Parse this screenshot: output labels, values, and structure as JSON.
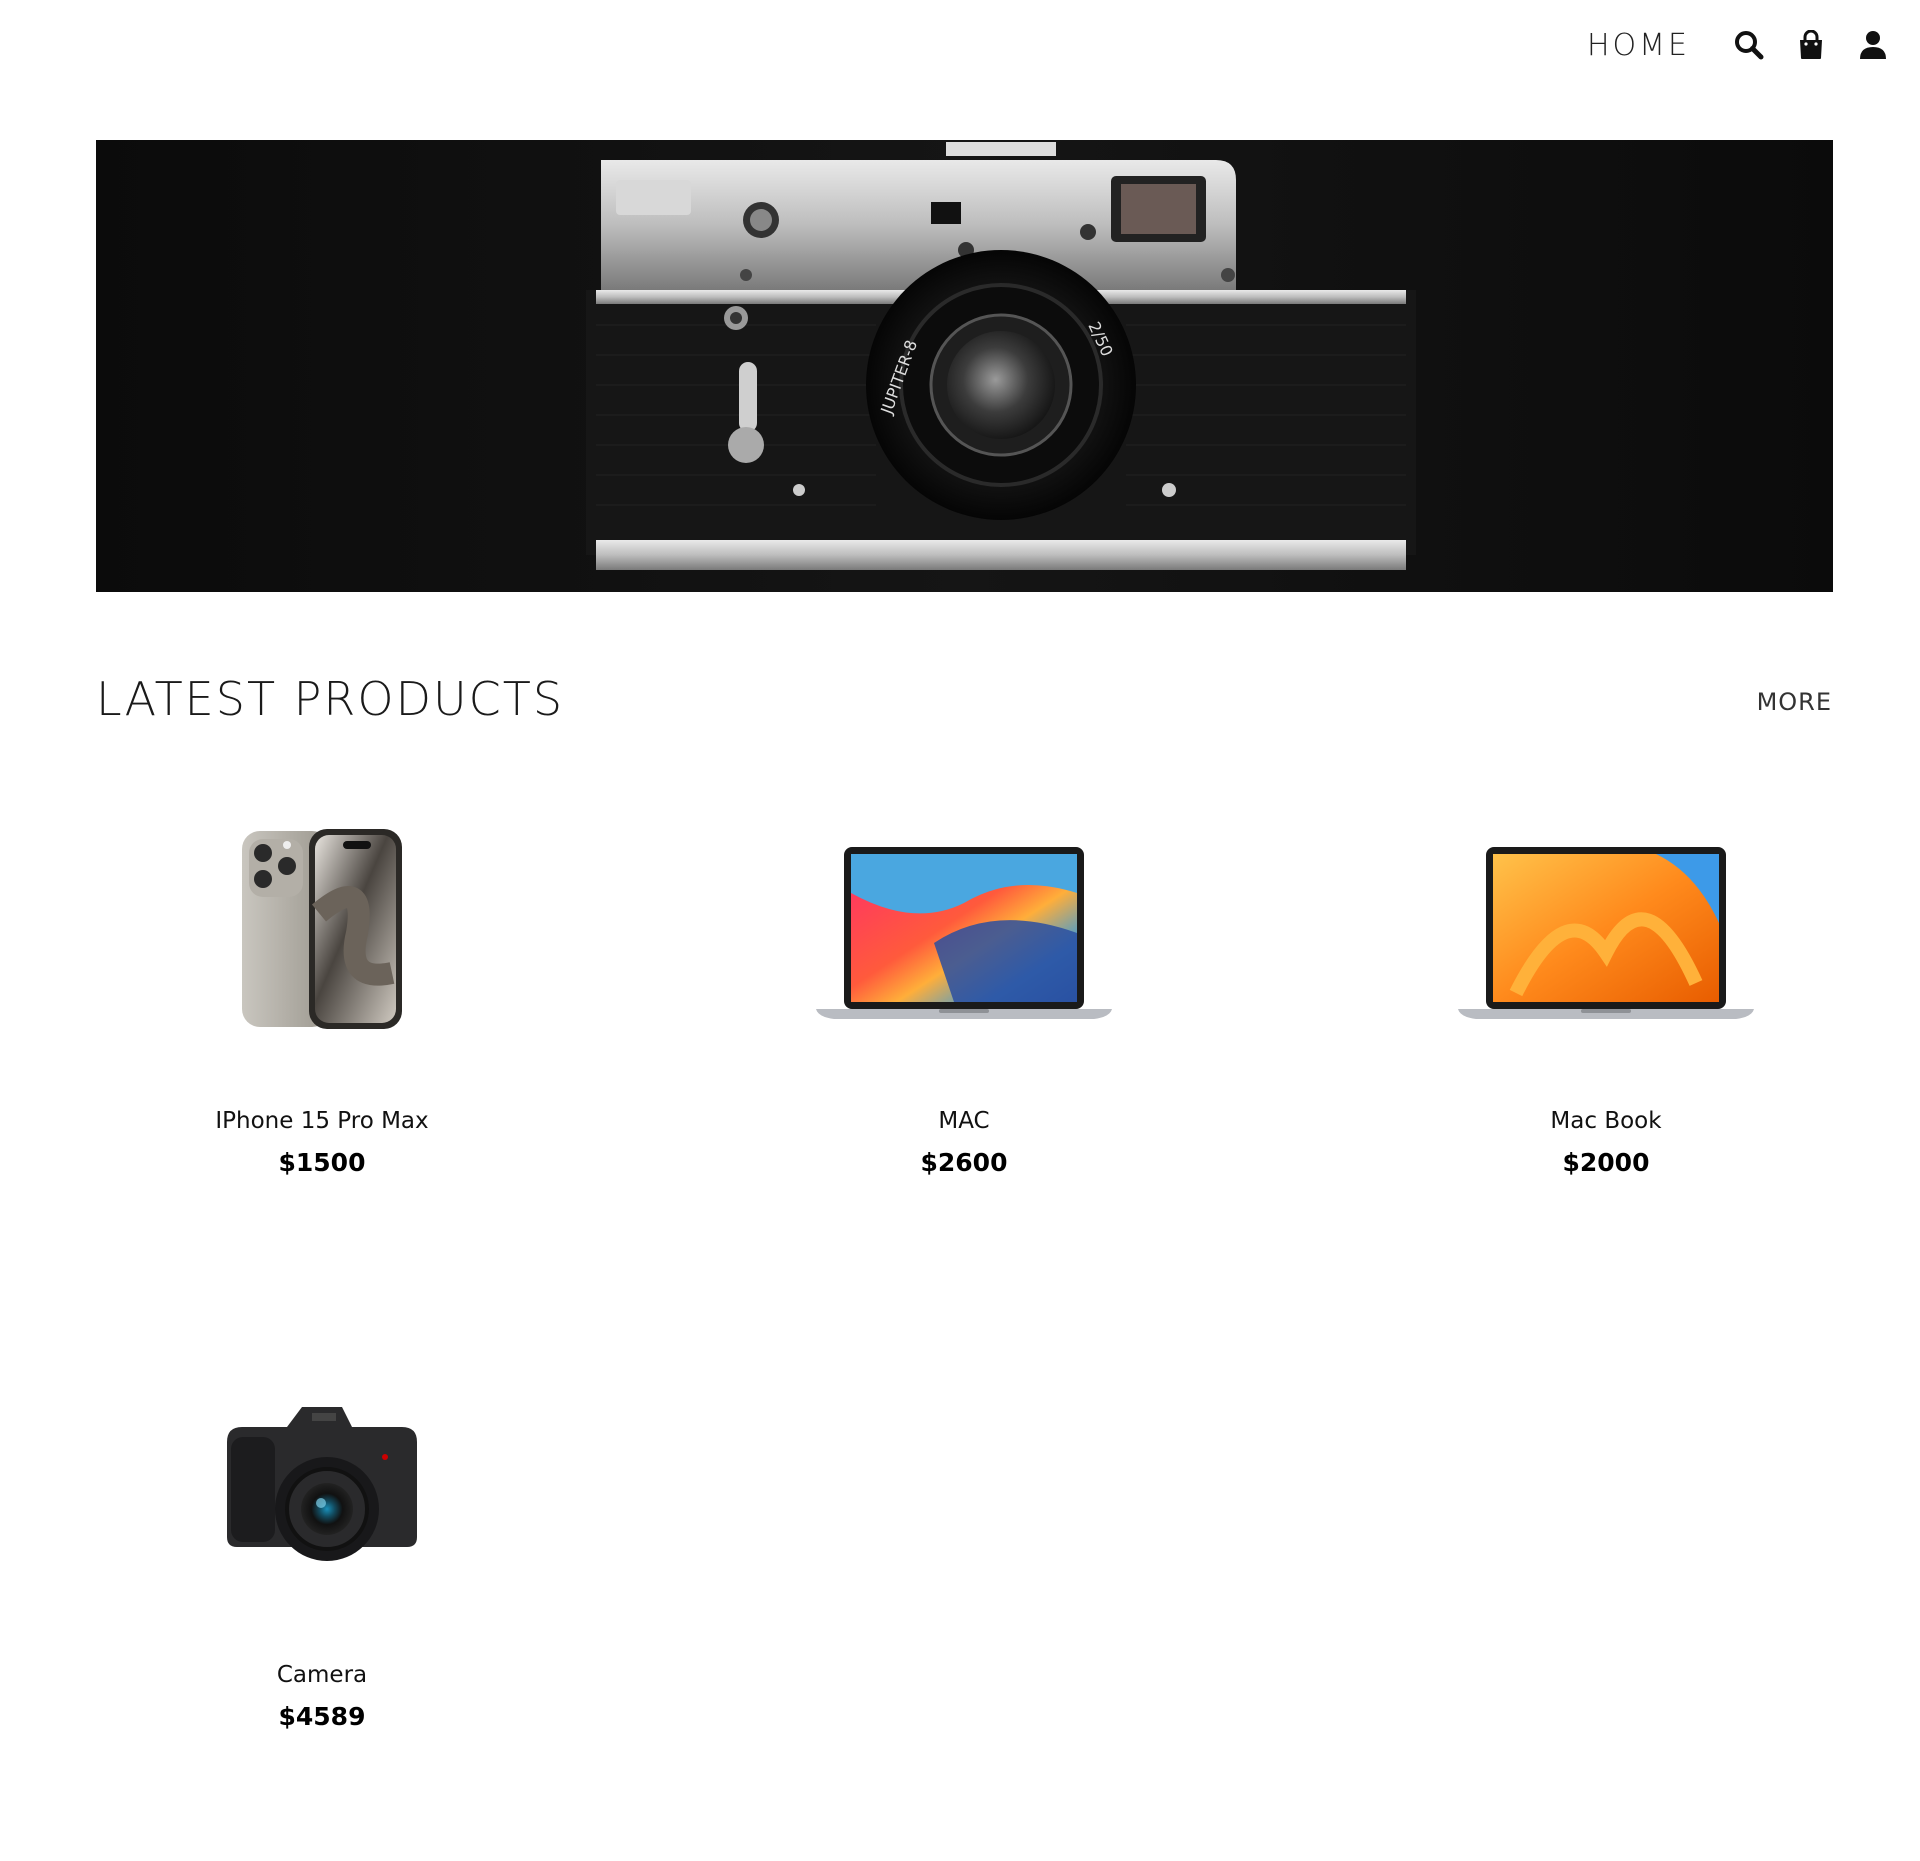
{
  "nav": {
    "home_label": "HOME",
    "icons": [
      "search-icon",
      "shopping-bag-icon",
      "user-icon"
    ]
  },
  "hero": {
    "image": "vintage-rangefinder-camera",
    "lens_text": "JUPITER-8",
    "lens_spec": "2/50"
  },
  "section": {
    "title": "LATEST PRODUCTS",
    "more_label": "MORE"
  },
  "products": [
    {
      "name": "IPhone 15 Pro Max",
      "price": "$1500",
      "image": "iphone-image"
    },
    {
      "name": "MAC",
      "price": "$2600",
      "image": "macbook-air-image"
    },
    {
      "name": "Mac Book",
      "price": "$2000",
      "image": "macbook-orange-image"
    },
    {
      "name": "Camera",
      "price": "$4589",
      "image": "canon-camera-image"
    }
  ],
  "colors": {
    "background": "#ffffff",
    "text": "#111111",
    "hero_bg": "#111111"
  }
}
